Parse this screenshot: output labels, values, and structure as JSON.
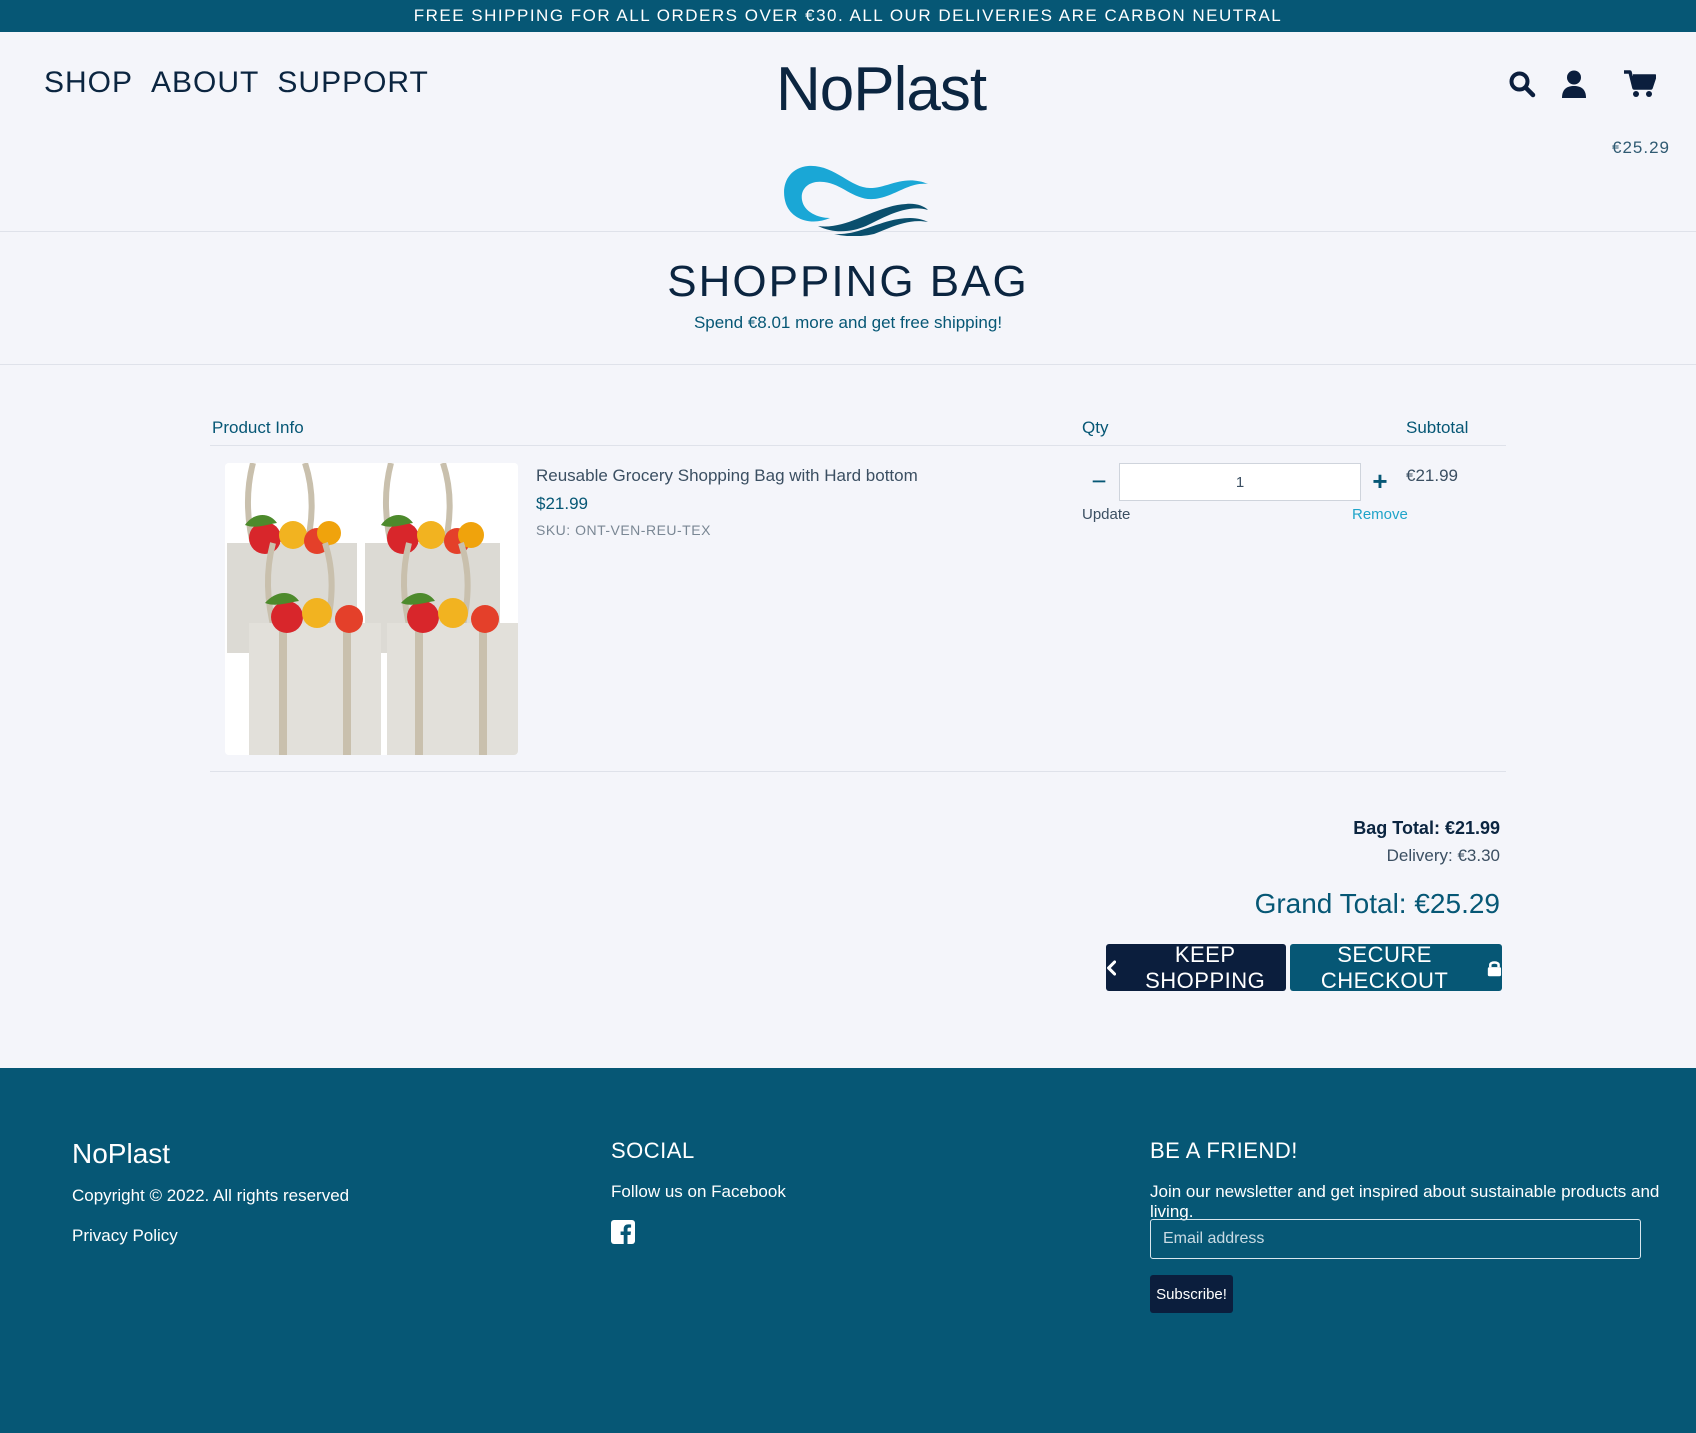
{
  "banner": {
    "text": "FREE SHIPPING FOR ALL ORDERS OVER €30. ALL OUR DELIVERIES ARE CARBON NEUTRAL"
  },
  "header": {
    "nav": [
      "SHOP",
      "ABOUT",
      "SUPPORT"
    ],
    "logo_text": "NoPlast",
    "icons": [
      "search-icon",
      "user-icon",
      "cart-icon"
    ],
    "cart_total": "€25.29"
  },
  "page": {
    "title": "SHOPPING BAG",
    "free_shipping_note": "Spend €8.01 more and get free shipping!"
  },
  "cart": {
    "columns": {
      "product": "Product Info",
      "qty": "Qty",
      "subtotal": "Subtotal"
    },
    "items": [
      {
        "name": "Reusable Grocery Shopping Bag with Hard bottom",
        "price": "$21.99",
        "sku": "SKU: ONT-VEN-REU-TEX",
        "quantity": "1",
        "update_label": "Update",
        "remove_label": "Remove",
        "subtotal": "€21.99"
      }
    ]
  },
  "totals": {
    "bag_total": "Bag Total: €21.99",
    "delivery": "Delivery: €3.30",
    "grand_total": "Grand Total: €25.29"
  },
  "buttons": {
    "keep_shopping": "KEEP SHOPPING",
    "secure_checkout": "SECURE CHECKOUT"
  },
  "footer": {
    "brand": "NoPlast",
    "copyright": "Copyright © 2022. All rights reserved",
    "privacy": "Privacy Policy",
    "social_heading": "SOCIAL",
    "follow_text": "Follow us on Facebook",
    "friend_heading": "BE A FRIEND!",
    "newsletter_text": "Join our newsletter and get inspired about sustainable products and living.",
    "email_placeholder": "Email address",
    "subscribe_label": "Subscribe!"
  },
  "colors": {
    "primary": "#065775",
    "dark": "#0b1e3d",
    "accent": "#1fa4c9",
    "background": "#f4f5fa"
  }
}
